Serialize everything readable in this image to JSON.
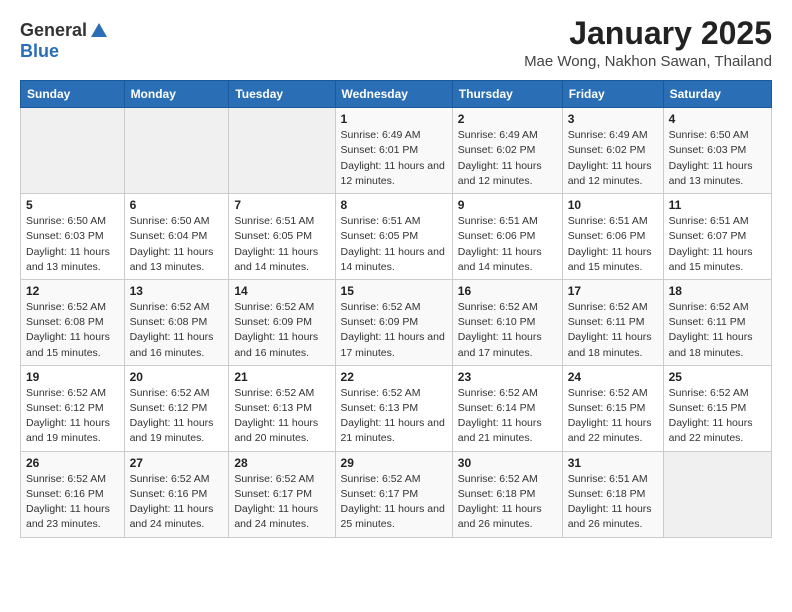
{
  "header": {
    "logo_general": "General",
    "logo_blue": "Blue",
    "title": "January 2025",
    "subtitle": "Mae Wong, Nakhon Sawan, Thailand"
  },
  "calendar": {
    "days_of_week": [
      "Sunday",
      "Monday",
      "Tuesday",
      "Wednesday",
      "Thursday",
      "Friday",
      "Saturday"
    ],
    "weeks": [
      [
        {
          "day": "",
          "empty": true
        },
        {
          "day": "",
          "empty": true
        },
        {
          "day": "",
          "empty": true
        },
        {
          "day": "1",
          "sunrise": "Sunrise: 6:49 AM",
          "sunset": "Sunset: 6:01 PM",
          "daylight": "Daylight: 11 hours and 12 minutes."
        },
        {
          "day": "2",
          "sunrise": "Sunrise: 6:49 AM",
          "sunset": "Sunset: 6:02 PM",
          "daylight": "Daylight: 11 hours and 12 minutes."
        },
        {
          "day": "3",
          "sunrise": "Sunrise: 6:49 AM",
          "sunset": "Sunset: 6:02 PM",
          "daylight": "Daylight: 11 hours and 12 minutes."
        },
        {
          "day": "4",
          "sunrise": "Sunrise: 6:50 AM",
          "sunset": "Sunset: 6:03 PM",
          "daylight": "Daylight: 11 hours and 13 minutes."
        }
      ],
      [
        {
          "day": "5",
          "sunrise": "Sunrise: 6:50 AM",
          "sunset": "Sunset: 6:03 PM",
          "daylight": "Daylight: 11 hours and 13 minutes."
        },
        {
          "day": "6",
          "sunrise": "Sunrise: 6:50 AM",
          "sunset": "Sunset: 6:04 PM",
          "daylight": "Daylight: 11 hours and 13 minutes."
        },
        {
          "day": "7",
          "sunrise": "Sunrise: 6:51 AM",
          "sunset": "Sunset: 6:05 PM",
          "daylight": "Daylight: 11 hours and 14 minutes."
        },
        {
          "day": "8",
          "sunrise": "Sunrise: 6:51 AM",
          "sunset": "Sunset: 6:05 PM",
          "daylight": "Daylight: 11 hours and 14 minutes."
        },
        {
          "day": "9",
          "sunrise": "Sunrise: 6:51 AM",
          "sunset": "Sunset: 6:06 PM",
          "daylight": "Daylight: 11 hours and 14 minutes."
        },
        {
          "day": "10",
          "sunrise": "Sunrise: 6:51 AM",
          "sunset": "Sunset: 6:06 PM",
          "daylight": "Daylight: 11 hours and 15 minutes."
        },
        {
          "day": "11",
          "sunrise": "Sunrise: 6:51 AM",
          "sunset": "Sunset: 6:07 PM",
          "daylight": "Daylight: 11 hours and 15 minutes."
        }
      ],
      [
        {
          "day": "12",
          "sunrise": "Sunrise: 6:52 AM",
          "sunset": "Sunset: 6:08 PM",
          "daylight": "Daylight: 11 hours and 15 minutes."
        },
        {
          "day": "13",
          "sunrise": "Sunrise: 6:52 AM",
          "sunset": "Sunset: 6:08 PM",
          "daylight": "Daylight: 11 hours and 16 minutes."
        },
        {
          "day": "14",
          "sunrise": "Sunrise: 6:52 AM",
          "sunset": "Sunset: 6:09 PM",
          "daylight": "Daylight: 11 hours and 16 minutes."
        },
        {
          "day": "15",
          "sunrise": "Sunrise: 6:52 AM",
          "sunset": "Sunset: 6:09 PM",
          "daylight": "Daylight: 11 hours and 17 minutes."
        },
        {
          "day": "16",
          "sunrise": "Sunrise: 6:52 AM",
          "sunset": "Sunset: 6:10 PM",
          "daylight": "Daylight: 11 hours and 17 minutes."
        },
        {
          "day": "17",
          "sunrise": "Sunrise: 6:52 AM",
          "sunset": "Sunset: 6:11 PM",
          "daylight": "Daylight: 11 hours and 18 minutes."
        },
        {
          "day": "18",
          "sunrise": "Sunrise: 6:52 AM",
          "sunset": "Sunset: 6:11 PM",
          "daylight": "Daylight: 11 hours and 18 minutes."
        }
      ],
      [
        {
          "day": "19",
          "sunrise": "Sunrise: 6:52 AM",
          "sunset": "Sunset: 6:12 PM",
          "daylight": "Daylight: 11 hours and 19 minutes."
        },
        {
          "day": "20",
          "sunrise": "Sunrise: 6:52 AM",
          "sunset": "Sunset: 6:12 PM",
          "daylight": "Daylight: 11 hours and 19 minutes."
        },
        {
          "day": "21",
          "sunrise": "Sunrise: 6:52 AM",
          "sunset": "Sunset: 6:13 PM",
          "daylight": "Daylight: 11 hours and 20 minutes."
        },
        {
          "day": "22",
          "sunrise": "Sunrise: 6:52 AM",
          "sunset": "Sunset: 6:13 PM",
          "daylight": "Daylight: 11 hours and 21 minutes."
        },
        {
          "day": "23",
          "sunrise": "Sunrise: 6:52 AM",
          "sunset": "Sunset: 6:14 PM",
          "daylight": "Daylight: 11 hours and 21 minutes."
        },
        {
          "day": "24",
          "sunrise": "Sunrise: 6:52 AM",
          "sunset": "Sunset: 6:15 PM",
          "daylight": "Daylight: 11 hours and 22 minutes."
        },
        {
          "day": "25",
          "sunrise": "Sunrise: 6:52 AM",
          "sunset": "Sunset: 6:15 PM",
          "daylight": "Daylight: 11 hours and 22 minutes."
        }
      ],
      [
        {
          "day": "26",
          "sunrise": "Sunrise: 6:52 AM",
          "sunset": "Sunset: 6:16 PM",
          "daylight": "Daylight: 11 hours and 23 minutes."
        },
        {
          "day": "27",
          "sunrise": "Sunrise: 6:52 AM",
          "sunset": "Sunset: 6:16 PM",
          "daylight": "Daylight: 11 hours and 24 minutes."
        },
        {
          "day": "28",
          "sunrise": "Sunrise: 6:52 AM",
          "sunset": "Sunset: 6:17 PM",
          "daylight": "Daylight: 11 hours and 24 minutes."
        },
        {
          "day": "29",
          "sunrise": "Sunrise: 6:52 AM",
          "sunset": "Sunset: 6:17 PM",
          "daylight": "Daylight: 11 hours and 25 minutes."
        },
        {
          "day": "30",
          "sunrise": "Sunrise: 6:52 AM",
          "sunset": "Sunset: 6:18 PM",
          "daylight": "Daylight: 11 hours and 26 minutes."
        },
        {
          "day": "31",
          "sunrise": "Sunrise: 6:51 AM",
          "sunset": "Sunset: 6:18 PM",
          "daylight": "Daylight: 11 hours and 26 minutes."
        },
        {
          "day": "",
          "empty": true
        }
      ]
    ]
  }
}
